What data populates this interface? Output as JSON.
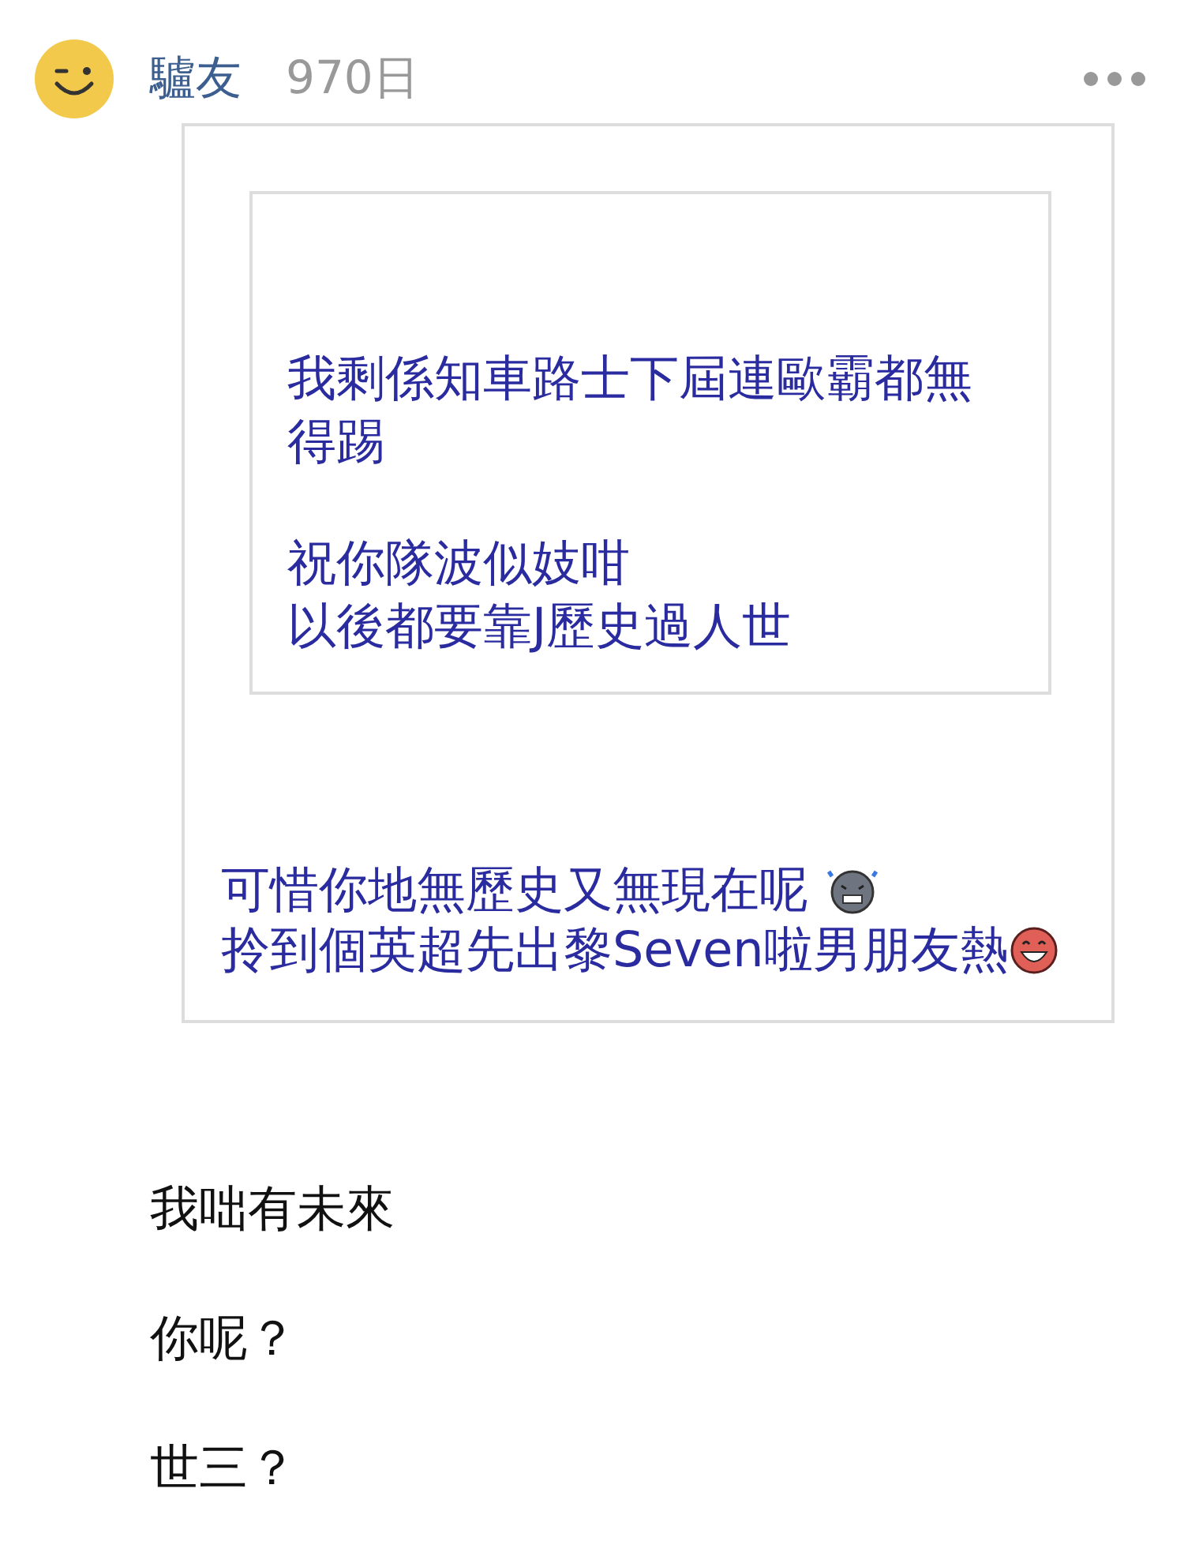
{
  "post": {
    "author": "驢友",
    "age": "970日",
    "quote": {
      "nested_quote": {
        "paragraphs": [
          [
            "我剩係知車路士下屆連歐霸都無得踢"
          ],
          [
            "祝你隊波似妓咁",
            "以後都要靠J歷史過人世"
          ]
        ]
      },
      "lines": [
        {
          "text": "可惜你地無歷史又無現在呢 ",
          "kind": "sweat"
        },
        {
          "text": "拎到個英超先出黎Seven啦男朋友熱",
          "kind": "laugh"
        }
      ]
    },
    "body": [
      "我咄有未來",
      "你呢？",
      "世三？"
    ]
  }
}
